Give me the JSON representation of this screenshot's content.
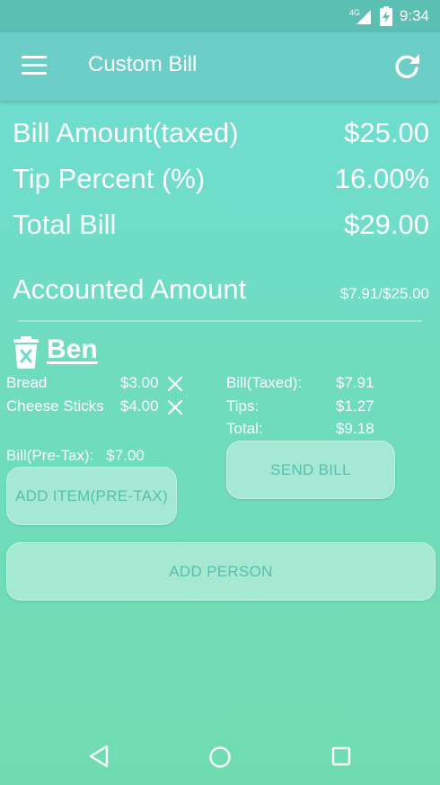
{
  "status_bar": {
    "network": "4G",
    "time": "9:34"
  },
  "app_bar": {
    "title": "Custom Bill"
  },
  "summary": {
    "bill_amount_label": "Bill Amount(taxed)",
    "bill_amount_value": "$25.00",
    "tip_percent_label": "Tip Percent (%)",
    "tip_percent_value": "16.00%",
    "total_bill_label": "Total Bill",
    "total_bill_value": "$29.00",
    "accounted_label": "Accounted Amount",
    "accounted_value": "$7.91/$25.00"
  },
  "person": {
    "name": "Ben",
    "items": [
      {
        "name": "Bread",
        "price": "$3.00"
      },
      {
        "name": "Cheese Sticks",
        "price": "$4.00"
      }
    ],
    "bill_taxed_label": "Bill(Taxed):",
    "bill_taxed_value": "$7.91",
    "tips_label": "Tips:",
    "tips_value": "$1.27",
    "total_label": "Total:",
    "total_value": "$9.18",
    "pretax_label": "Bill(Pre-Tax):",
    "pretax_value": "$7.00",
    "add_item_label": "ADD ITEM(PRE-TAX)",
    "send_bill_label": "SEND BILL"
  },
  "add_person_label": "ADD PERSON",
  "icons": {
    "menu": "menu-icon",
    "refresh": "refresh-icon",
    "delete": "trash-icon",
    "remove": "close-icon",
    "nav_back": "triangle-back-icon",
    "nav_home": "circle-home-icon",
    "nav_recent": "square-recent-icon"
  },
  "colors": {
    "status_bar": "#5cbfb4",
    "app_bar": "#6ccfc7",
    "background_top": "#6fded6",
    "background_bottom": "#6fdcb0",
    "button_text": "#59bfae"
  }
}
